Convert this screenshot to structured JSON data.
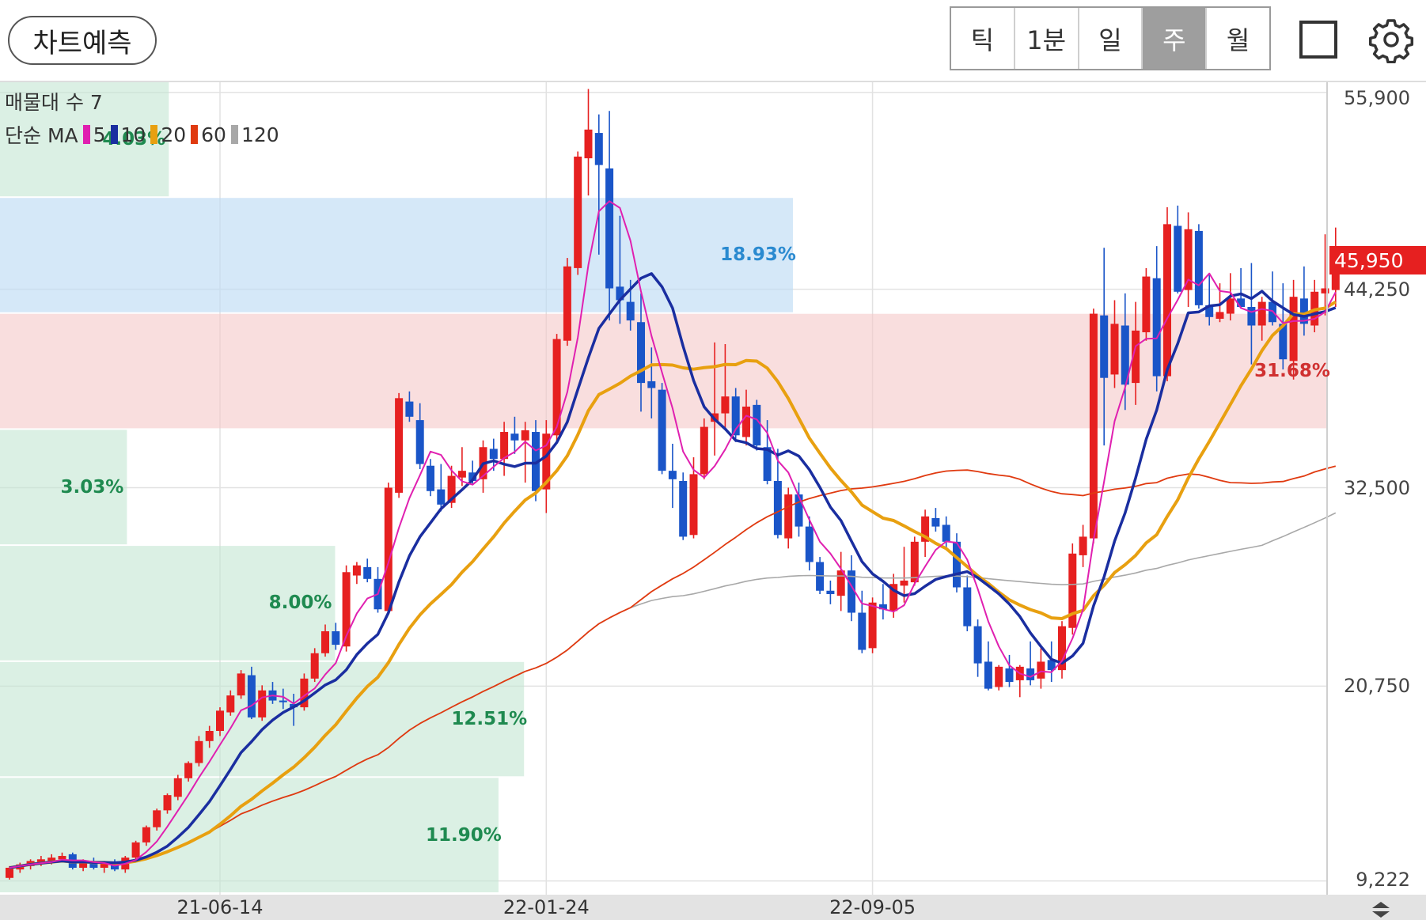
{
  "toolbar": {
    "predict_label": "차트예측",
    "tabs": [
      {
        "label": "틱",
        "active": false
      },
      {
        "label": "1분",
        "active": false
      },
      {
        "label": "일",
        "active": false
      },
      {
        "label": "주",
        "active": true
      },
      {
        "label": "월",
        "active": false
      }
    ],
    "square_icon": "square-outline-icon",
    "settings_icon": "gear-icon"
  },
  "legend": {
    "volume_profile": "매물대 수 7",
    "ma_type": "단순 MA",
    "ma_periods": [
      {
        "period": "5",
        "color": "#e020b0"
      },
      {
        "period": "10",
        "color": "#1a2ea0"
      },
      {
        "period": "20",
        "color": "#e8a010"
      },
      {
        "period": "60",
        "color": "#e03a10"
      },
      {
        "period": "120",
        "color": "#a8a8a8"
      }
    ]
  },
  "current_price": "45,950",
  "colors": {
    "up": "#e62020",
    "down": "#1a55c8",
    "price_tag": "#e62020"
  },
  "chart_data": {
    "type": "candlestick",
    "interval": "weekly",
    "y_ticks": [
      {
        "label": "55,900",
        "value": 55900
      },
      {
        "label": "44,250",
        "value": 44250
      },
      {
        "label": "32,500",
        "value": 32500
      },
      {
        "label": "20,750",
        "value": 20750
      },
      {
        "label": "9,222",
        "value": 9222
      }
    ],
    "ylim": [
      8500,
      56500
    ],
    "x_labels": [
      {
        "label": "21-06-14",
        "index": 20
      },
      {
        "label": "22-01-24",
        "index": 51
      },
      {
        "label": "22-09-05",
        "index": 82
      }
    ],
    "candles": [
      [
        9400,
        10100,
        9300,
        10000
      ],
      [
        9900,
        10300,
        9700,
        10200
      ],
      [
        10100,
        10500,
        9900,
        10400
      ],
      [
        10300,
        10700,
        10100,
        10500
      ],
      [
        10400,
        10800,
        10200,
        10600
      ],
      [
        10500,
        10900,
        10300,
        10700
      ],
      [
        10800,
        10900,
        9900,
        10000
      ],
      [
        10000,
        10500,
        9800,
        10400
      ],
      [
        10300,
        10600,
        9900,
        10000
      ],
      [
        10000,
        10400,
        9700,
        10300
      ],
      [
        10200,
        10500,
        9800,
        9900
      ],
      [
        9900,
        10700,
        9700,
        10600
      ],
      [
        10600,
        11600,
        10400,
        11500
      ],
      [
        11500,
        12500,
        11300,
        12400
      ],
      [
        12400,
        13500,
        12200,
        13400
      ],
      [
        13400,
        14400,
        13200,
        14300
      ],
      [
        14200,
        15500,
        14000,
        15300
      ],
      [
        15300,
        16300,
        15100,
        16200
      ],
      [
        16200,
        17800,
        16000,
        17500
      ],
      [
        17500,
        18400,
        17100,
        18100
      ],
      [
        18100,
        19500,
        17800,
        19300
      ],
      [
        19200,
        20500,
        19000,
        20200
      ],
      [
        20200,
        21700,
        20000,
        21500
      ],
      [
        21400,
        21900,
        18800,
        18900
      ],
      [
        18900,
        20800,
        18700,
        20500
      ],
      [
        20500,
        21000,
        19700,
        19900
      ],
      [
        19900,
        20600,
        19400,
        19800
      ],
      [
        19700,
        20300,
        18400,
        19500
      ],
      [
        19500,
        21500,
        19300,
        21200
      ],
      [
        21200,
        23000,
        21000,
        22700
      ],
      [
        22700,
        24400,
        22500,
        24000
      ],
      [
        24000,
        24500,
        22900,
        23200
      ],
      [
        23100,
        27900,
        22800,
        27500
      ],
      [
        27300,
        28100,
        26800,
        27900
      ],
      [
        27800,
        28300,
        26900,
        27100
      ],
      [
        27100,
        27800,
        25100,
        25300
      ],
      [
        25200,
        32800,
        25000,
        32500
      ],
      [
        32200,
        38100,
        31900,
        37800
      ],
      [
        37600,
        38200,
        36400,
        36700
      ],
      [
        36500,
        37500,
        33600,
        33900
      ],
      [
        33800,
        34200,
        32000,
        32300
      ],
      [
        32400,
        33900,
        31100,
        31500
      ],
      [
        31600,
        33800,
        31300,
        33200
      ],
      [
        33100,
        34900,
        32600,
        33500
      ],
      [
        33400,
        34100,
        32700,
        32900
      ],
      [
        33000,
        35300,
        32200,
        34900
      ],
      [
        34800,
        35400,
        33500,
        34200
      ],
      [
        34200,
        36400,
        33200,
        35800
      ],
      [
        35700,
        36700,
        34500,
        35300
      ],
      [
        35300,
        36400,
        32800,
        35900
      ],
      [
        35800,
        36500,
        31700,
        32300
      ],
      [
        32400,
        36500,
        31000,
        35700
      ],
      [
        35600,
        41600,
        35200,
        41300
      ],
      [
        41200,
        46100,
        40900,
        45600
      ],
      [
        45500,
        52400,
        45100,
        52100
      ],
      [
        52000,
        56100,
        49800,
        53700
      ],
      [
        53500,
        54600,
        46300,
        51600
      ],
      [
        51400,
        54800,
        42400,
        44300
      ],
      [
        44400,
        48600,
        42200,
        43600
      ],
      [
        43500,
        44800,
        41800,
        42400
      ],
      [
        42300,
        44000,
        37000,
        38700
      ],
      [
        38800,
        40800,
        36600,
        38400
      ],
      [
        38300,
        38700,
        33300,
        33500
      ],
      [
        33500,
        35100,
        31300,
        33000
      ],
      [
        32900,
        33400,
        29400,
        29600
      ],
      [
        29700,
        34300,
        29500,
        33300
      ],
      [
        33300,
        36600,
        33000,
        36100
      ],
      [
        36400,
        41100,
        34400,
        36900
      ],
      [
        36900,
        41000,
        35900,
        37900
      ],
      [
        37900,
        38400,
        35200,
        35600
      ],
      [
        35500,
        38300,
        35000,
        37300
      ],
      [
        37400,
        37700,
        34700,
        35000
      ],
      [
        34900,
        36500,
        32700,
        32900
      ],
      [
        32900,
        34800,
        29500,
        29700
      ],
      [
        29500,
        32500,
        28900,
        32100
      ],
      [
        32100,
        32800,
        29600,
        30200
      ],
      [
        30200,
        30800,
        27600,
        28100
      ],
      [
        28100,
        28400,
        26200,
        26400
      ],
      [
        26400,
        27000,
        25600,
        26200
      ],
      [
        26100,
        28700,
        25200,
        27600
      ],
      [
        27600,
        28500,
        24600,
        25100
      ],
      [
        25100,
        26400,
        22700,
        22900
      ],
      [
        23000,
        26000,
        22700,
        25700
      ],
      [
        25600,
        26800,
        24700,
        25300
      ],
      [
        25200,
        27400,
        24800,
        26800
      ],
      [
        26700,
        29000,
        25700,
        27000
      ],
      [
        26900,
        29600,
        26700,
        29300
      ],
      [
        29300,
        31200,
        28400,
        30800
      ],
      [
        30700,
        31300,
        29900,
        30200
      ],
      [
        30300,
        30800,
        28800,
        29300
      ],
      [
        29300,
        29800,
        26300,
        26600
      ],
      [
        26600,
        27300,
        24000,
        24300
      ],
      [
        24300,
        24700,
        21300,
        22100
      ],
      [
        22200,
        23400,
        20500,
        20600
      ],
      [
        20700,
        22000,
        20500,
        21900
      ],
      [
        21800,
        22600,
        20700,
        21000
      ],
      [
        21100,
        22000,
        20100,
        21900
      ],
      [
        21800,
        23400,
        20800,
        21100
      ],
      [
        21200,
        23000,
        20600,
        22200
      ],
      [
        22300,
        23400,
        21000,
        21700
      ],
      [
        21700,
        24600,
        21200,
        24300
      ],
      [
        24200,
        29200,
        23800,
        28600
      ],
      [
        28500,
        30300,
        27800,
        29600
      ],
      [
        29500,
        43100,
        29200,
        42800
      ],
      [
        42700,
        46700,
        35000,
        39000
      ],
      [
        39200,
        43600,
        38400,
        42200
      ],
      [
        42100,
        44000,
        37100,
        38600
      ],
      [
        38700,
        43500,
        37400,
        41800
      ],
      [
        41700,
        45500,
        41200,
        45000
      ],
      [
        44900,
        46800,
        38200,
        39100
      ],
      [
        39100,
        49100,
        38800,
        48100
      ],
      [
        48000,
        49200,
        44000,
        44100
      ],
      [
        44200,
        48800,
        43200,
        47800
      ],
      [
        47700,
        48100,
        43100,
        43300
      ],
      [
        43300,
        45100,
        42100,
        42600
      ],
      [
        42500,
        44600,
        42300,
        42900
      ],
      [
        42800,
        45200,
        42400,
        43700
      ],
      [
        43700,
        45500,
        43100,
        43200
      ],
      [
        43200,
        45800,
        39800,
        42100
      ],
      [
        42100,
        43800,
        41200,
        43500
      ],
      [
        43500,
        45300,
        42100,
        42300
      ],
      [
        42200,
        44600,
        39500,
        40100
      ],
      [
        40000,
        44800,
        38900,
        43800
      ],
      [
        43700,
        45600,
        41500,
        42200
      ],
      [
        42100,
        44800,
        41700,
        44100
      ],
      [
        44000,
        47500,
        42700,
        44300
      ],
      [
        44200,
        47900,
        43200,
        45950
      ]
    ],
    "volume_profile": [
      {
        "price_from": 8500,
        "price_to": 15370,
        "percent": "11.90%"
      },
      {
        "price_from": 15370,
        "price_to": 22230,
        "percent": "12.51%"
      },
      {
        "price_from": 22230,
        "price_to": 29100,
        "percent": "8.00%"
      },
      {
        "price_from": 29100,
        "price_to": 35970,
        "percent": "3.03%"
      },
      {
        "price_from": 35970,
        "price_to": 42840,
        "percent": "31.68%"
      },
      {
        "price_from": 42840,
        "price_to": 49700,
        "percent": "18.93%"
      },
      {
        "price_from": 49700,
        "price_to": 56570,
        "percent": "4.03%"
      }
    ]
  }
}
